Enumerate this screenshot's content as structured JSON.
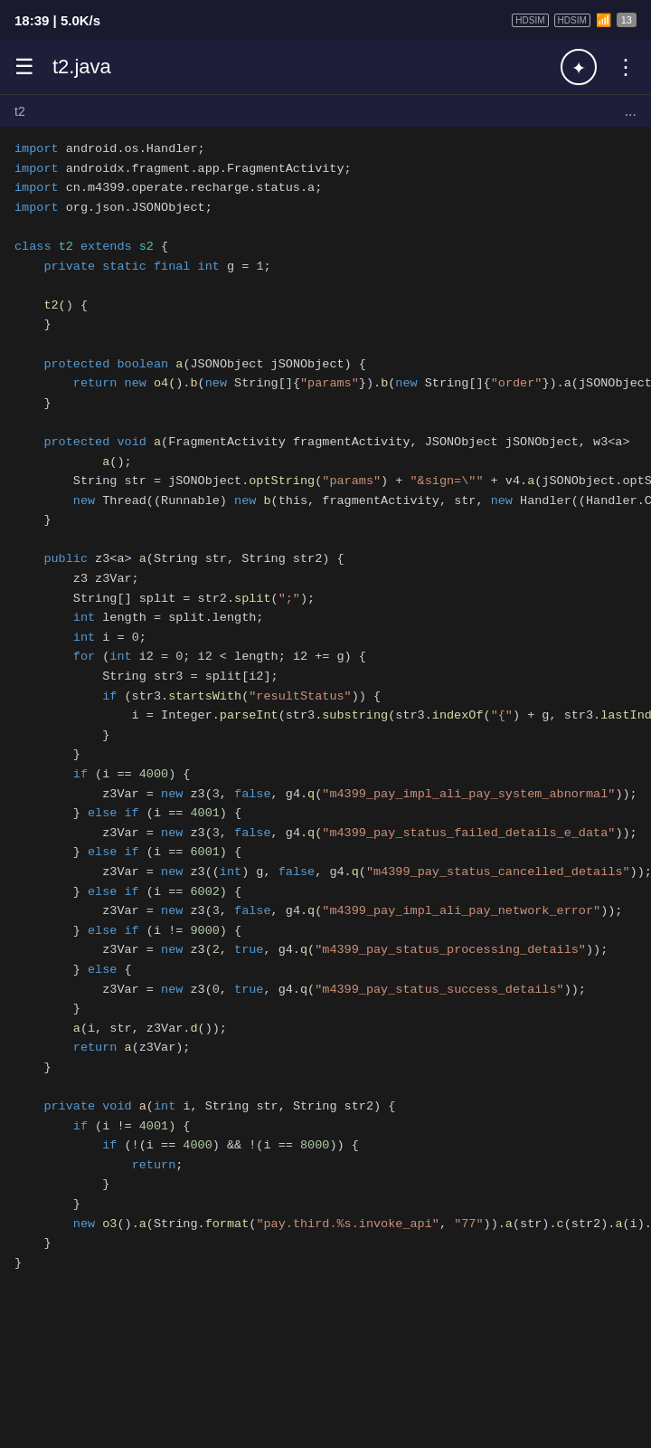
{
  "statusBar": {
    "time": "18:39",
    "speed": "5.0K/s",
    "sim1": "HDSIM",
    "sim2": "HDSIM",
    "wifi": "Wi-Fi",
    "battery": "13"
  },
  "appBar": {
    "title": "t2.java",
    "hamburgerLabel": "Menu",
    "compassLabel": "Navigate",
    "moreLabel": "More options"
  },
  "breadcrumb": {
    "path": "t2",
    "dots": "..."
  },
  "code": {
    "lines": []
  }
}
